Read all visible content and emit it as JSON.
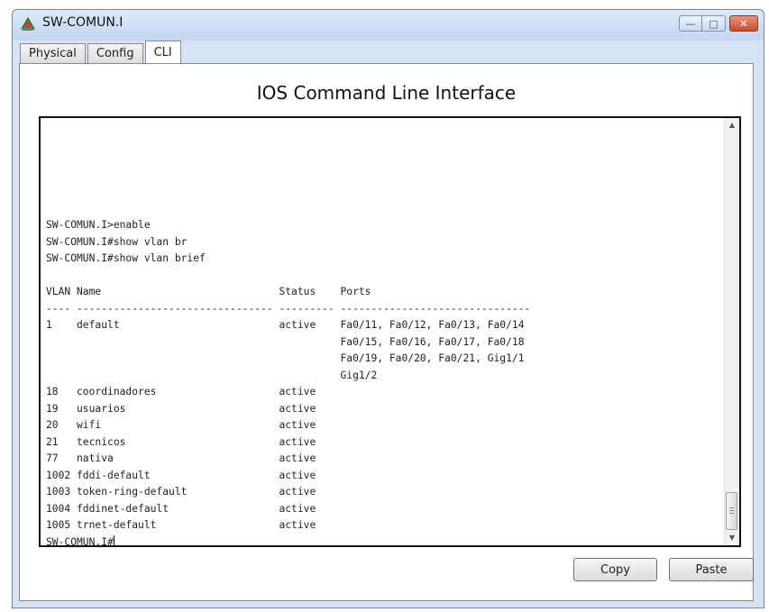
{
  "window": {
    "title": "SW-COMUN.I",
    "controls": {
      "minimize": "—",
      "maximize": "□",
      "close": "✕"
    }
  },
  "tabs": [
    {
      "label": "Physical",
      "active": false
    },
    {
      "label": "Config",
      "active": false
    },
    {
      "label": "CLI",
      "active": true
    }
  ],
  "cli": {
    "heading": "IOS Command Line Interface",
    "output_lines": [
      "SW-COMUN.I>enable",
      "SW-COMUN.I#show vlan br",
      "SW-COMUN.I#show vlan brief",
      "",
      "VLAN Name                             Status    Ports",
      "---- -------------------------------- --------- -------------------------------",
      "1    default                          active    Fa0/11, Fa0/12, Fa0/13, Fa0/14",
      "                                                Fa0/15, Fa0/16, Fa0/17, Fa0/18",
      "                                                Fa0/19, Fa0/20, Fa0/21, Gig1/1",
      "                                                Gig1/2",
      "18   coordinadores                    active",
      "19   usuarios                         active",
      "20   wifi                             active",
      "21   tecnicos                         active",
      "77   nativa                           active",
      "1002 fddi-default                     active",
      "1003 token-ring-default               active",
      "1004 fddinet-default                  active",
      "1005 trnet-default                    active"
    ],
    "prompt": "SW-COMUN.I#"
  },
  "buttons": {
    "copy": "Copy",
    "paste": "Paste"
  },
  "icons": {
    "app": "network-switch-icon"
  }
}
